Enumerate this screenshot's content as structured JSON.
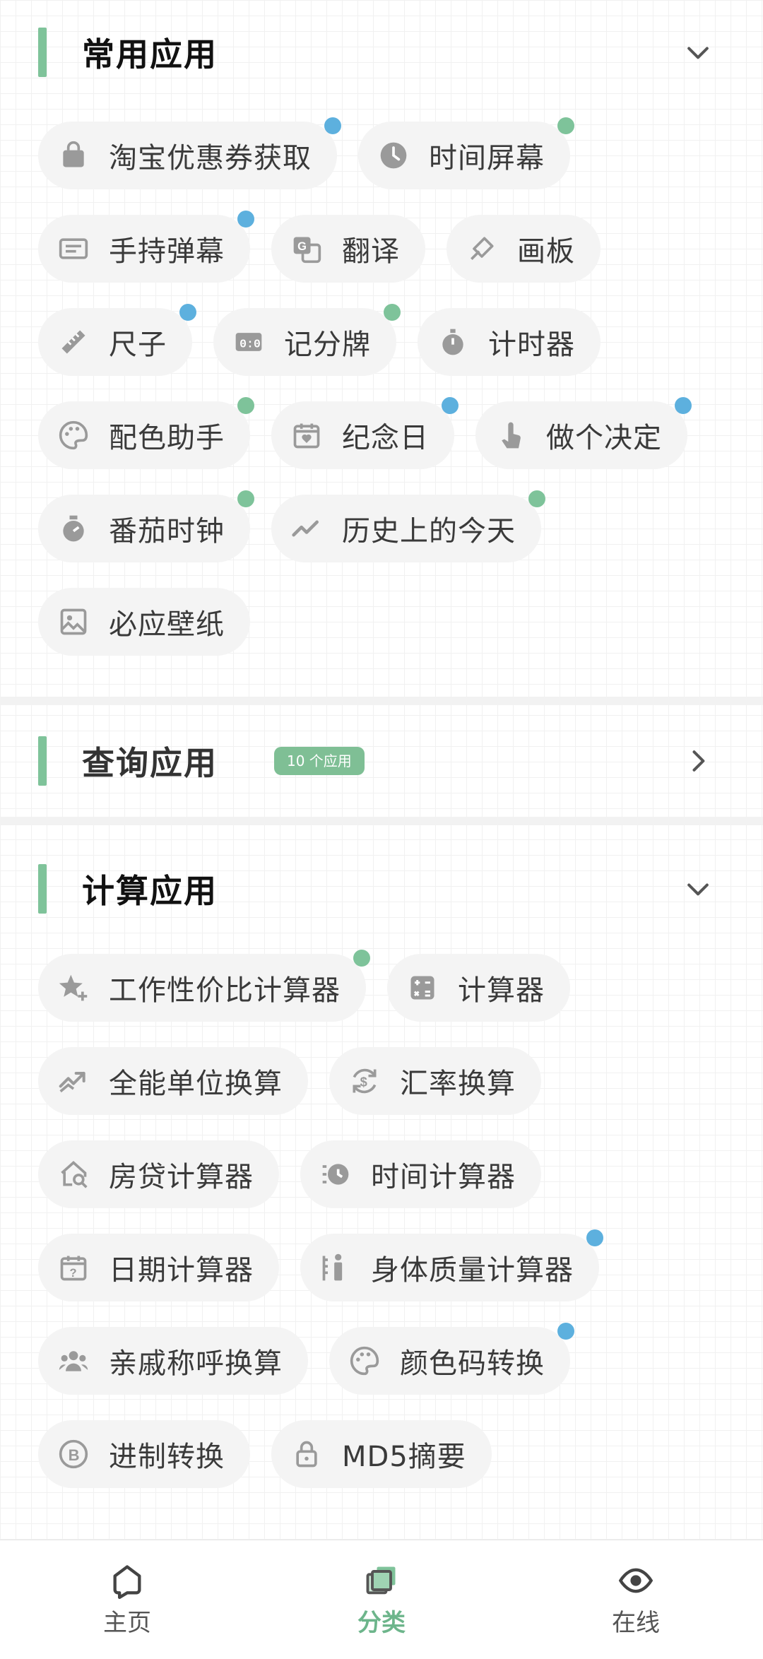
{
  "sections": {
    "common": {
      "title": "常用应用",
      "items": [
        {
          "label": "淘宝优惠券获取",
          "icon": "shopping-bag-icon",
          "dot": "blue"
        },
        {
          "label": "时间屏幕",
          "icon": "clock-icon",
          "dot": "green"
        },
        {
          "label": "手持弹幕",
          "icon": "danmaku-icon",
          "dot": "blue"
        },
        {
          "label": "翻译",
          "icon": "translate-icon",
          "dot": ""
        },
        {
          "label": "画板",
          "icon": "brush-icon",
          "dot": ""
        },
        {
          "label": "尺子",
          "icon": "ruler-icon",
          "dot": "blue"
        },
        {
          "label": "记分牌",
          "icon": "scoreboard-icon",
          "dot": "green"
        },
        {
          "label": "计时器",
          "icon": "stopwatch-icon",
          "dot": ""
        },
        {
          "label": "配色助手",
          "icon": "palette-icon",
          "dot": "green"
        },
        {
          "label": "纪念日",
          "icon": "calendar-heart-icon",
          "dot": "blue"
        },
        {
          "label": "做个决定",
          "icon": "tap-icon",
          "dot": "blue"
        },
        {
          "label": "番茄时钟",
          "icon": "timer-icon",
          "dot": "green"
        },
        {
          "label": "历史上的今天",
          "icon": "trend-icon",
          "dot": "green"
        },
        {
          "label": "必应壁纸",
          "icon": "image-icon",
          "dot": ""
        }
      ]
    },
    "query": {
      "title": "查询应用",
      "badge": "10 个应用"
    },
    "calc": {
      "title": "计算应用",
      "items": [
        {
          "label": "工作性价比计算器",
          "icon": "star-plus-icon",
          "dot": "green"
        },
        {
          "label": "计算器",
          "icon": "calculator-icon",
          "dot": ""
        },
        {
          "label": "全能单位换算",
          "icon": "unit-convert-icon",
          "dot": ""
        },
        {
          "label": "汇率换算",
          "icon": "currency-exchange-icon",
          "dot": ""
        },
        {
          "label": "房贷计算器",
          "icon": "house-search-icon",
          "dot": ""
        },
        {
          "label": "时间计算器",
          "icon": "clock-history-icon",
          "dot": ""
        },
        {
          "label": "日期计算器",
          "icon": "calendar-question-icon",
          "dot": ""
        },
        {
          "label": "身体质量计算器",
          "icon": "body-measure-icon",
          "dot": "blue"
        },
        {
          "label": "亲戚称呼换算",
          "icon": "people-icon",
          "dot": ""
        },
        {
          "label": "颜色码转换",
          "icon": "palette-icon",
          "dot": "blue"
        },
        {
          "label": "进制转换",
          "icon": "binary-icon",
          "dot": ""
        },
        {
          "label": "MD5摘要",
          "icon": "lock-icon",
          "dot": ""
        }
      ]
    }
  },
  "tabs": [
    {
      "label": "主页",
      "icon": "home-icon",
      "active": false
    },
    {
      "label": "分类",
      "icon": "category-icon",
      "active": true
    },
    {
      "label": "在线",
      "icon": "eye-icon",
      "active": false
    }
  ],
  "colors": {
    "accent": "#7fc39a",
    "dot_blue": "#5db0de",
    "dot_green": "#7ec39a",
    "active_tab": "#6db58b"
  }
}
